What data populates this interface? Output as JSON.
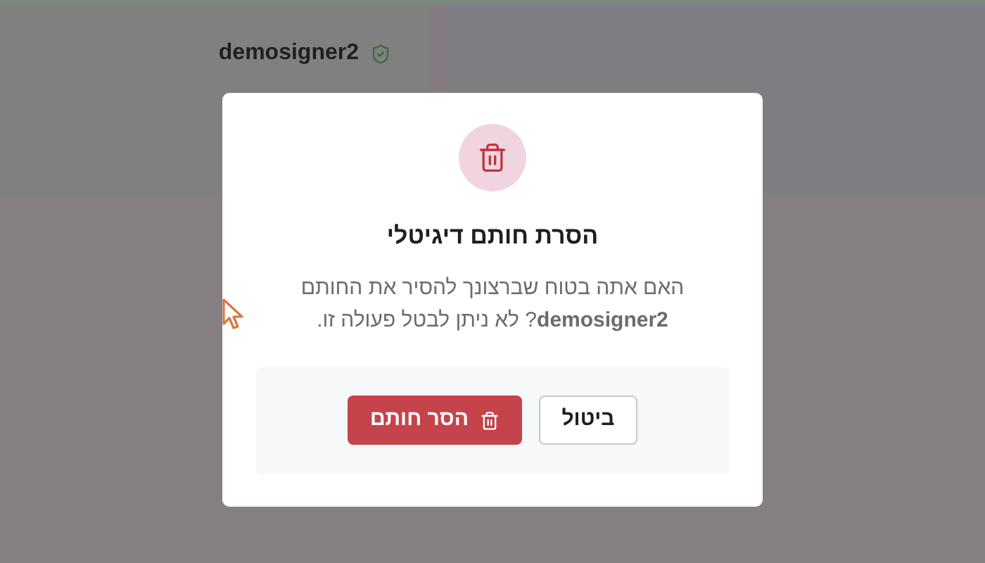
{
  "background": {
    "signer_name": "demosigner2"
  },
  "dialog": {
    "title": "הסרת חותם דיגיטלי",
    "message": "האם אתה בטוח שברצונך להסיר את החותם **demosigner2**? לא ניתן לבטל פעולה זו.",
    "buttons": [
      {
        "kind": "secondary",
        "label": "ביטול"
      },
      {
        "kind": "danger",
        "label": "הסר חותם"
      }
    ]
  }
}
